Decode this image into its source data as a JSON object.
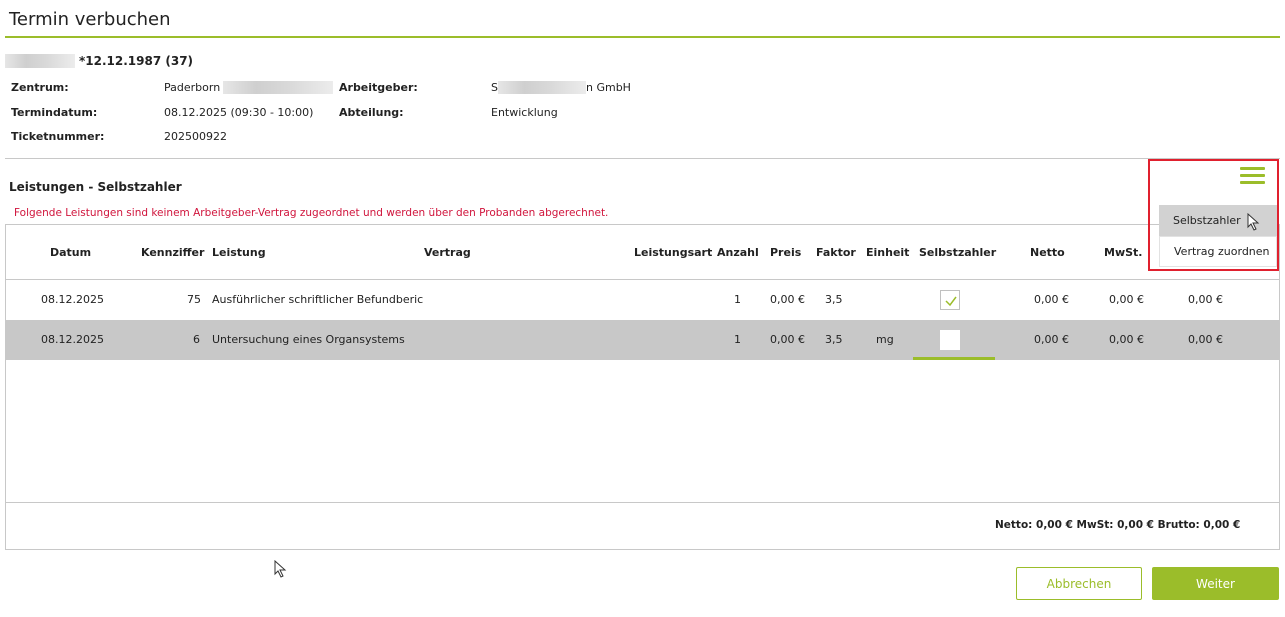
{
  "page": {
    "title": "Termin verbuchen"
  },
  "patient": {
    "dob": "*12.12.1987 (37)",
    "fields": {
      "zentrum_label": "Zentrum:",
      "zentrum_value": "Paderborn",
      "arbeitgeber_label": "Arbeitgeber:",
      "arbeitgeber_prefix": "S",
      "arbeitgeber_suffix": "n GmbH",
      "termindatum_label": "Termindatum:",
      "termindatum_value": "08.12.2025 (09:30 - 10:00)",
      "abteilung_label": "Abteilung:",
      "abteilung_value": "Entwicklung",
      "ticket_label": "Ticketnummer:",
      "ticket_value": "202500922"
    }
  },
  "section": {
    "title": "Leistungen - Selbstzahler",
    "warning": "Folgende Leistungen sind keinem Arbeitgeber-Vertrag zugeordnet und werden über den Probanden abgerechnet."
  },
  "menu": {
    "icon": "hamburger-icon",
    "items": [
      "Selbstzahler",
      "Vertrag zuordnen"
    ]
  },
  "table": {
    "headers": [
      "Datum",
      "Kennziffer",
      "Leistung",
      "Vertrag",
      "Leistungsart",
      "Anzahl",
      "Preis",
      "Faktor",
      "Einheit",
      "Selbstzahler",
      "Netto",
      "MwSt."
    ],
    "rows": [
      {
        "datum": "08.12.2025",
        "kennziffer": "75",
        "leistung": "Ausführlicher schriftlicher Befundberic",
        "anzahl": "1",
        "preis": "0,00 €",
        "faktor": "3,5",
        "einheit": "",
        "selbstzahler": true,
        "netto": "0,00 €",
        "mwst": "0,00 €",
        "brutto": "0,00 €"
      },
      {
        "datum": "08.12.2025",
        "kennziffer": "6",
        "leistung": "Untersuchung eines Organsystems",
        "anzahl": "1",
        "preis": "0,00 €",
        "faktor": "3,5",
        "einheit": "mg",
        "selbstzahler": false,
        "netto": "0,00 €",
        "mwst": "0,00 €",
        "brutto": "0,00 €"
      }
    ],
    "totals": "Netto: 0,00 €  MwSt: 0,00 €  Brutto: 0,00 €"
  },
  "buttons": {
    "cancel": "Abbrechen",
    "next": "Weiter"
  },
  "colors": {
    "accent": "#9bbd2a",
    "warning": "#d0143c",
    "highlight_border": "#e0202e",
    "row_selected": "#c8c8c8"
  }
}
